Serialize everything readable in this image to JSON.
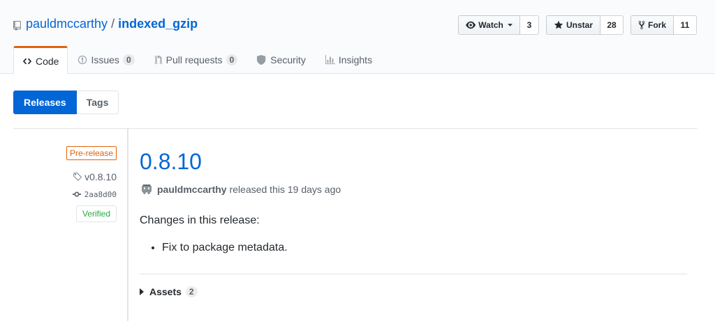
{
  "repo": {
    "owner": "pauldmccarthy",
    "separator": "/",
    "name": "indexed_gzip"
  },
  "actions": {
    "watch": {
      "label": "Watch",
      "count": "3"
    },
    "star": {
      "label": "Unstar",
      "count": "28"
    },
    "fork": {
      "label": "Fork",
      "count": "11"
    }
  },
  "tabs": [
    {
      "label": "Code"
    },
    {
      "label": "Issues",
      "count": "0"
    },
    {
      "label": "Pull requests",
      "count": "0"
    },
    {
      "label": "Security"
    },
    {
      "label": "Insights"
    }
  ],
  "subnav": {
    "releases": "Releases",
    "tags": "Tags"
  },
  "release": {
    "badge": "Pre-release",
    "tag": "v0.8.10",
    "commit": "2aa8d00",
    "verified": "Verified",
    "title": "0.8.10",
    "author": "pauldmccarthy",
    "released_text": "released this 19 days ago",
    "notes_intro": "Changes in this release:",
    "notes_items": [
      "Fix to package metadata."
    ],
    "assets_label": "Assets",
    "assets_count": "2"
  },
  "colors": {
    "accent": "#0366d6",
    "prerelease": "#e36209",
    "verified": "#28a745",
    "tab_underline": "#e36209"
  }
}
